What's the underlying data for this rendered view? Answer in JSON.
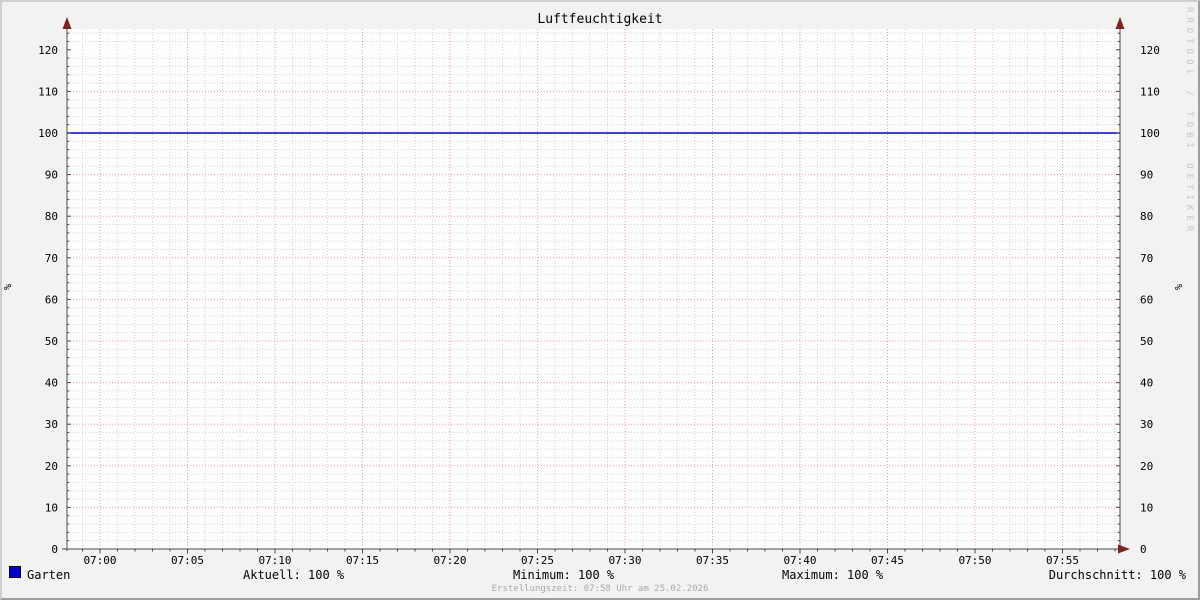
{
  "title": "Luftfeuchtigkeit",
  "watermark": "RRDTOOL / TOBI OETIKER",
  "footer": "Erstellungszeit: 07:58 Uhr am 25.02.2026",
  "y_axis": {
    "unit": "%"
  },
  "legend": {
    "series_label": "Garten",
    "series_color": "#0000cc",
    "stats": [
      {
        "label": "Aktuell",
        "value": "100 %",
        "text": "Aktuell: 100 %"
      },
      {
        "label": "Minimum",
        "value": "100 %",
        "text": "Minimum: 100 %"
      },
      {
        "label": "Maximum",
        "value": "100 %",
        "text": "Maximum: 100 %"
      },
      {
        "label": "Durchschnitt",
        "value": "100 %",
        "text": "Durchschnitt: 100 %"
      }
    ]
  },
  "chart_data": {
    "type": "line",
    "title": "Luftfeuchtigkeit",
    "ylabel": "%",
    "ylabel_right": "%",
    "ylim": [
      0,
      125
    ],
    "y_major_step": 10,
    "y_minor_step": 2,
    "y_tick_labels": [
      0,
      10,
      20,
      30,
      40,
      50,
      60,
      70,
      80,
      90,
      100,
      110,
      120
    ],
    "x_range": [
      "06:58",
      "07:58"
    ],
    "x_major_step_minutes": 5,
    "x_minor_step_minutes": 1,
    "x_major_labels": [
      "07:00",
      "07:05",
      "07:10",
      "07:15",
      "07:20",
      "07:25",
      "07:30",
      "07:35",
      "07:40",
      "07:45",
      "07:50",
      "07:55"
    ],
    "series": [
      {
        "name": "Garten",
        "color": "#0000cc",
        "value": 100
      }
    ],
    "stats": {
      "aktuell": 100,
      "minimum": 100,
      "maximum": 100,
      "durchschnitt": 100,
      "unit": "%"
    },
    "grid_on": true,
    "legend_position": "bottom",
    "colors": {
      "background": "#f2f2f2",
      "canvas": "#fdfdfd",
      "minor_grid": "#d4d4d4",
      "major_grid": "#ef9d9d",
      "axis": "#4a4a4a",
      "arrow": "#7d2321",
      "text": "#000000"
    }
  }
}
